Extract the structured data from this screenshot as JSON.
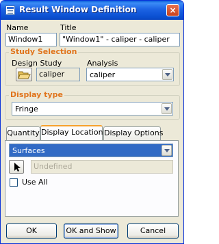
{
  "window": {
    "title": "Result Window Definition",
    "close_glyph": "×"
  },
  "labels": {
    "name": "Name",
    "title": "Title"
  },
  "fields": {
    "name_value": "Window1",
    "title_value": "\"Window1\" - caliper - caliper"
  },
  "study_selection": {
    "group_title": "Study Selection",
    "design_study_label": "Design Study",
    "design_study_value": "caliper",
    "analysis_label": "Analysis",
    "analysis_value": "caliper"
  },
  "display_type": {
    "group_title": "Display type",
    "value": "Fringe"
  },
  "tabs": [
    {
      "label": "Quantity"
    },
    {
      "label": "Display Location",
      "active": true
    },
    {
      "label": "Display Options"
    }
  ],
  "display_location": {
    "location_value": "Surfaces",
    "selection_value": "Undefined",
    "use_all_label": "Use All",
    "use_all_checked": false
  },
  "buttons": {
    "ok": "OK",
    "ok_and_show": "OK and Show",
    "cancel": "Cancel"
  },
  "colors": {
    "group_title": "#e0741c",
    "selection": "#316ac5",
    "titlebar": "#0a4fd0"
  },
  "icons": {
    "window": "window-icon",
    "close": "close-icon",
    "open_folder": "open-folder-icon",
    "select_arrow": "select-arrow-icon"
  }
}
